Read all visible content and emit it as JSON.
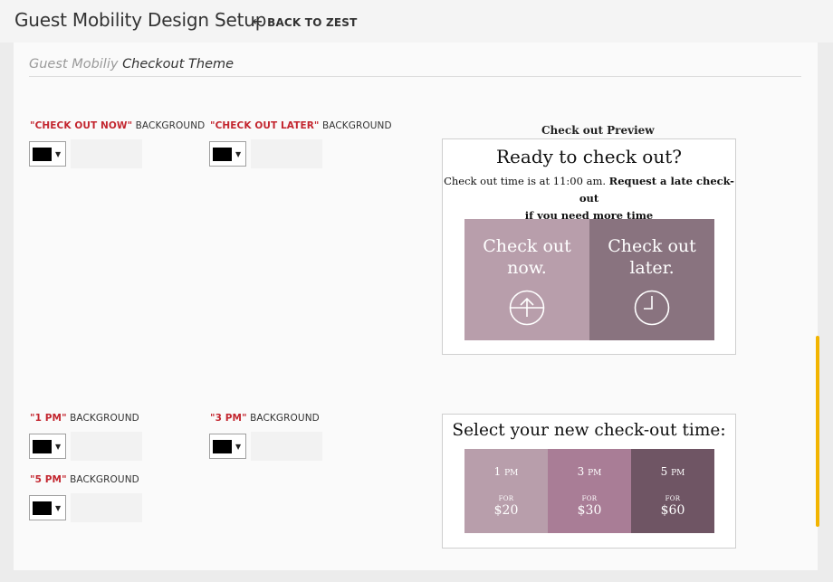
{
  "header": {
    "title": "Guest Mobility Design Setup",
    "back_label": "BACK TO ZEST"
  },
  "section": {
    "title_muted": "Guest Mobiliy",
    "title_main": "Checkout Theme"
  },
  "fields": {
    "checkout_now": {
      "accent": "\"CHECK OUT NOW\"",
      "suffix": " BACKGROUND",
      "value": ""
    },
    "checkout_later": {
      "accent": "\"CHECK OUT LATER\"",
      "suffix": " BACKGROUND",
      "value": ""
    },
    "pm1": {
      "accent": "\"1 PM\"",
      "suffix": " BACKGROUND",
      "value": ""
    },
    "pm3": {
      "accent": "\"3 PM\"",
      "suffix": " BACKGROUND",
      "value": ""
    },
    "pm5": {
      "accent": "\"5 PM\"",
      "suffix": " BACKGROUND",
      "value": ""
    }
  },
  "preview": {
    "title": "Check out Preview",
    "heading": "Ready to check out?",
    "line1": "Check out time is at 11:00 am.",
    "line1_bold": "Request a late check-out",
    "line2_bold": "if you need more time",
    "now_label": "Check out now.",
    "later_label": "Check out later.",
    "now_color": "#b89eab",
    "later_color": "#89737f",
    "upload_icon": "circle-arrow-up-icon",
    "clock_icon": "clock-icon"
  },
  "time_preview": {
    "heading": "Select your new check-out time:",
    "options": [
      {
        "hour": "1",
        "suffix": "PM",
        "for": "FOR",
        "price": "$20",
        "color": "#b89eab"
      },
      {
        "hour": "3",
        "suffix": "PM",
        "for": "FOR",
        "price": "$30",
        "color": "#a97d96"
      },
      {
        "hour": "5",
        "suffix": "PM",
        "for": "FOR",
        "price": "$60",
        "color": "#6f5564"
      }
    ]
  },
  "colors": {
    "accent": "#c3262f",
    "swatch": "#000000",
    "scrollbar": "#f2b400"
  }
}
